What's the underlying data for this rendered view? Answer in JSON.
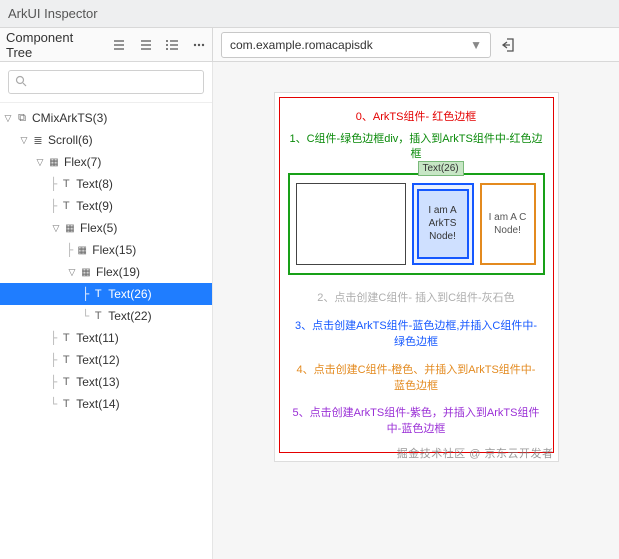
{
  "titlebar": {
    "title": "ArkUI Inspector"
  },
  "toolbar": {
    "tree_label": "Component Tree",
    "app_name": "com.example.romacapisdk"
  },
  "tree": {
    "root": {
      "label": "CMixArkTS(3)"
    },
    "scroll": {
      "label": "Scroll(6)"
    },
    "flex7": {
      "label": "Flex(7)"
    },
    "text8": {
      "label": "Text(8)"
    },
    "text9": {
      "label": "Text(9)"
    },
    "flex5": {
      "label": "Flex(5)"
    },
    "flex15": {
      "label": "Flex(15)"
    },
    "flex19": {
      "label": "Flex(19)"
    },
    "text26": {
      "label": "Text(26)"
    },
    "text22": {
      "label": "Text(22)"
    },
    "text11": {
      "label": "Text(11)"
    },
    "text12": {
      "label": "Text(12)"
    },
    "text13": {
      "label": "Text(13)"
    },
    "text14": {
      "label": "Text(14)"
    }
  },
  "preview": {
    "red_title": "0、ArkTS组件- 红色边框",
    "green_title": "1、C组件-绿色边框div，插入到ArkTS组件中-红色边框",
    "tag": "Text(26)",
    "blue_text": "I am A ArkTS Node!",
    "orange_text": "I am A C Node!",
    "cap2": "2、点击创建C组件- 插入到C组件-灰石色",
    "cap3": "3、点击创建ArkTS组件-蓝色边框,并插入C组件中-绿色边框",
    "cap4": "4、点击创建C组件-橙色、并插入到ArkTS组件中-蓝色边框",
    "cap5": "5、点击创建ArkTS组件-紫色，并插入到ArkTS组件中-蓝色边框",
    "watermark": "掘金技术社区 @ 京东云开发者"
  }
}
